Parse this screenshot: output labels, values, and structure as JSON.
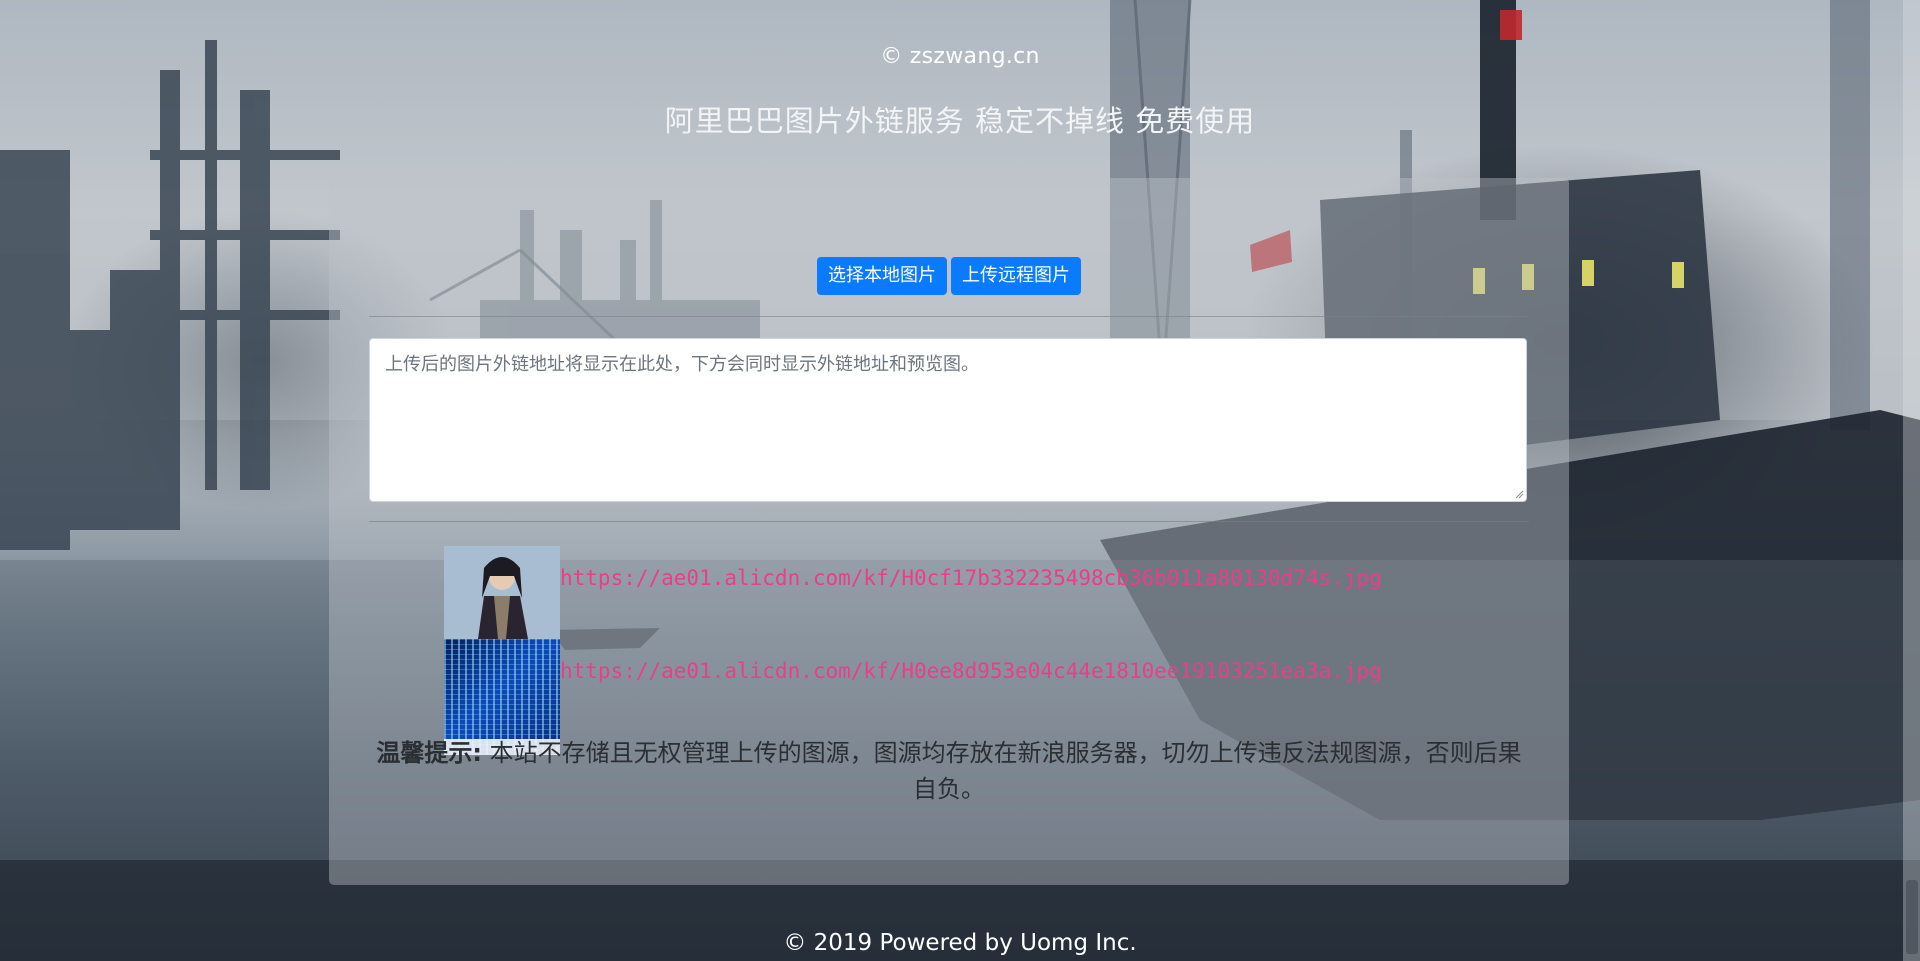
{
  "header": {
    "site_title": "© zszwang.cn",
    "subtitle": "阿里巴巴图片外链服务 稳定不掉线 免费使用"
  },
  "toolbar": {
    "select_local_label": "选择本地图片",
    "upload_remote_label": "上传远程图片"
  },
  "output": {
    "placeholder": "上传后的图片外链地址将显示在此处，下方会同时显示外链地址和预览图。"
  },
  "results": [
    {
      "thumbnail": "character-portrait-image",
      "url": "https://ae01.alicdn.com/kf/H0cf17b332235498cb36b011a80130d74s.jpg"
    },
    {
      "thumbnail": "blue-binary-data-image",
      "url": "https://ae01.alicdn.com/kf/H0ee8d953e04c44e1810ee19103251ea3a.jpg"
    }
  ],
  "notice": {
    "label": "温馨提示:",
    "text": " 本站不存储且无权管理上传的图源，图源均存放在新浪服务器，切勿上传违反法规图源，否则后果自负。"
  },
  "footer": {
    "text": "© 2019 Powered by Uomg Inc."
  },
  "colors": {
    "primary_button": "#0a7bff",
    "link": "#e83e8c",
    "panel_overlay": "rgba(190,195,202,0.42)"
  }
}
